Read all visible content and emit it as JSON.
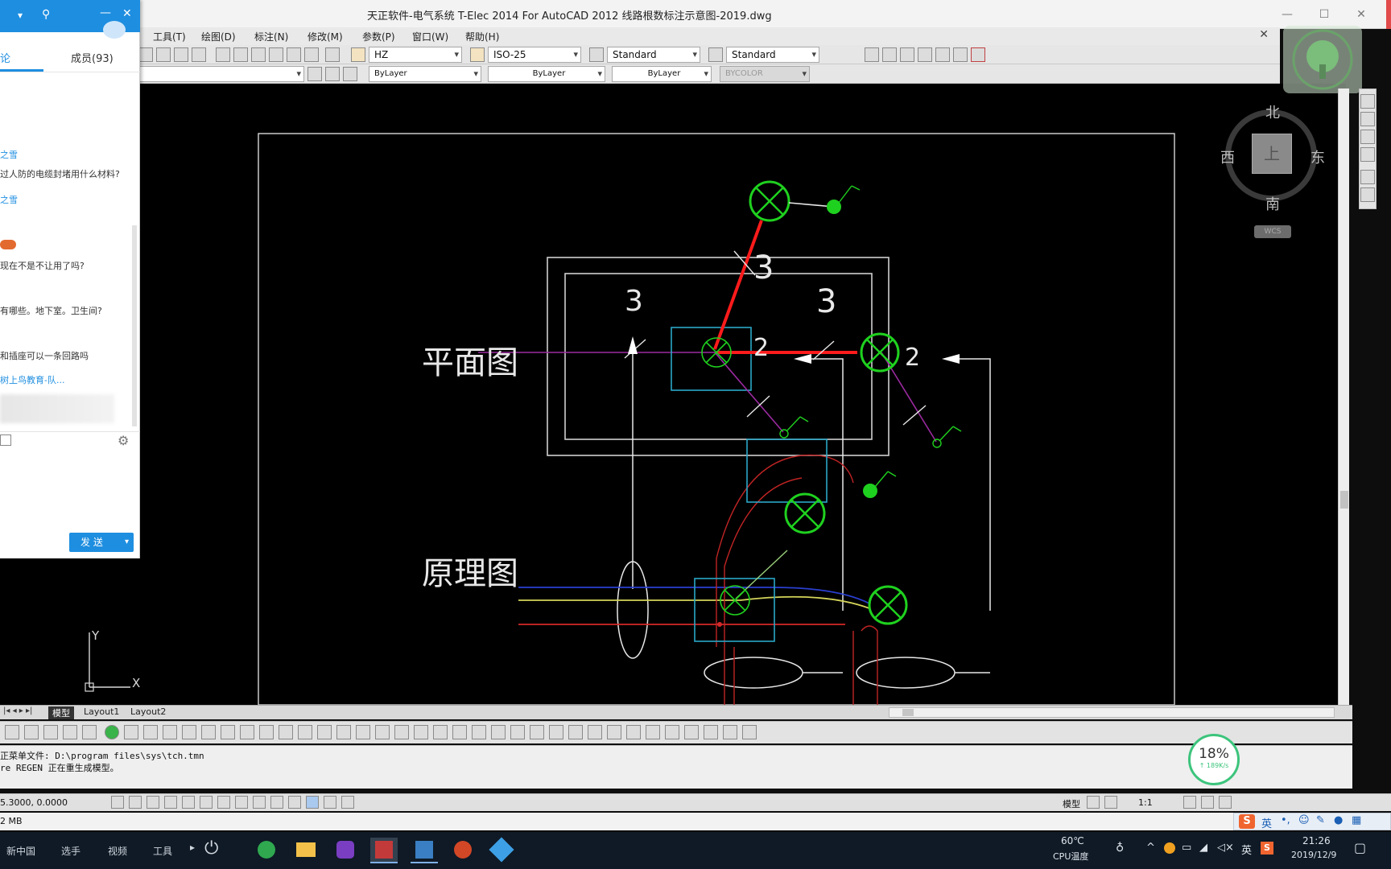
{
  "window": {
    "title": "天正软件-电气系统 T-Elec 2014  For AutoCAD 2012      线路根数标注示意图-2019.dwg"
  },
  "menu": [
    "工具(T)",
    "绘图(D)",
    "标注(N)",
    "修改(M)",
    "参数(P)",
    "窗口(W)",
    "帮助(H)"
  ],
  "toolbar": {
    "text_style": "HZ",
    "dim_style": "ISO-25",
    "table_style": "Standard",
    "multileader_style": "Standard",
    "layer_color": "ByLayer",
    "linetype": "ByLayer",
    "lineweight": "ByLayer",
    "plot_style": "BYCOLOR"
  },
  "chat": {
    "tab_members": "成员(93)",
    "tab_discuss": "论",
    "messages": [
      {
        "name": "之雪",
        "text": "过人防的电缆封堵用什么材料?"
      },
      {
        "name": "之雪",
        "text": ""
      },
      {
        "name": "",
        "text": "现在不是不让用了吗?"
      },
      {
        "name": "",
        "text": "有哪些。地下室。卫生间?"
      },
      {
        "name": "",
        "text": "和插座可以一条回路吗"
      },
      {
        "name": "树上鸟教育-队...",
        "text": ""
      }
    ],
    "send_label": "发 送"
  },
  "viewcube": {
    "north": "北",
    "south": "南",
    "east": "东",
    "west": "西",
    "top": "上",
    "wcs": "WCS"
  },
  "drawing": {
    "label_plan": "平面图",
    "label_schematic": "原理图",
    "count_3a": "3",
    "count_3b": "3",
    "count_3c": "3",
    "count_2a": "2",
    "count_2b": "2"
  },
  "ucs": {
    "x": "X",
    "y": "Y"
  },
  "layout_tabs": [
    "模型",
    "Layout1",
    "Layout2"
  ],
  "command": {
    "line1": "正菜单文件: D:\\program files\\sys\\tch.tmn",
    "line2": "re REGEN 正在重生成模型。"
  },
  "status": {
    "coords": "5.3000, 0.0000",
    "model": "模型",
    "scale": "1:1"
  },
  "memory": "2 MB",
  "perf": {
    "percent": "18%",
    "speed": "↑ 189K/s"
  },
  "taskbar": {
    "item1": "新中国",
    "item2": "选手",
    "item3": "视频",
    "item4": "工具",
    "temp": "60℃",
    "temp_label": "CPU温度",
    "lang": "英",
    "time": "21:26",
    "date": "2019/12/9"
  },
  "ime": {
    "lang": "英"
  }
}
